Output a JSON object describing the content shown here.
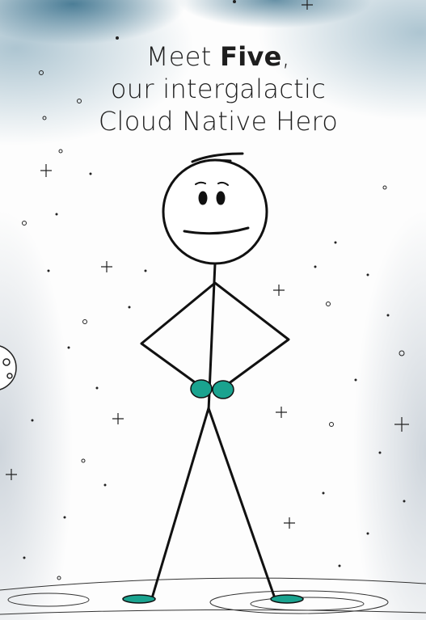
{
  "headline": {
    "line1_prefix": "Meet ",
    "line1_name": "Five",
    "line1_suffix": ",",
    "line2": "our intergalactic",
    "line3": "Cloud Native Hero"
  },
  "colors": {
    "accent": "#1aa38f",
    "ink": "#111111",
    "sky": "#3f7f99"
  },
  "illustration": "stick-figure-character"
}
